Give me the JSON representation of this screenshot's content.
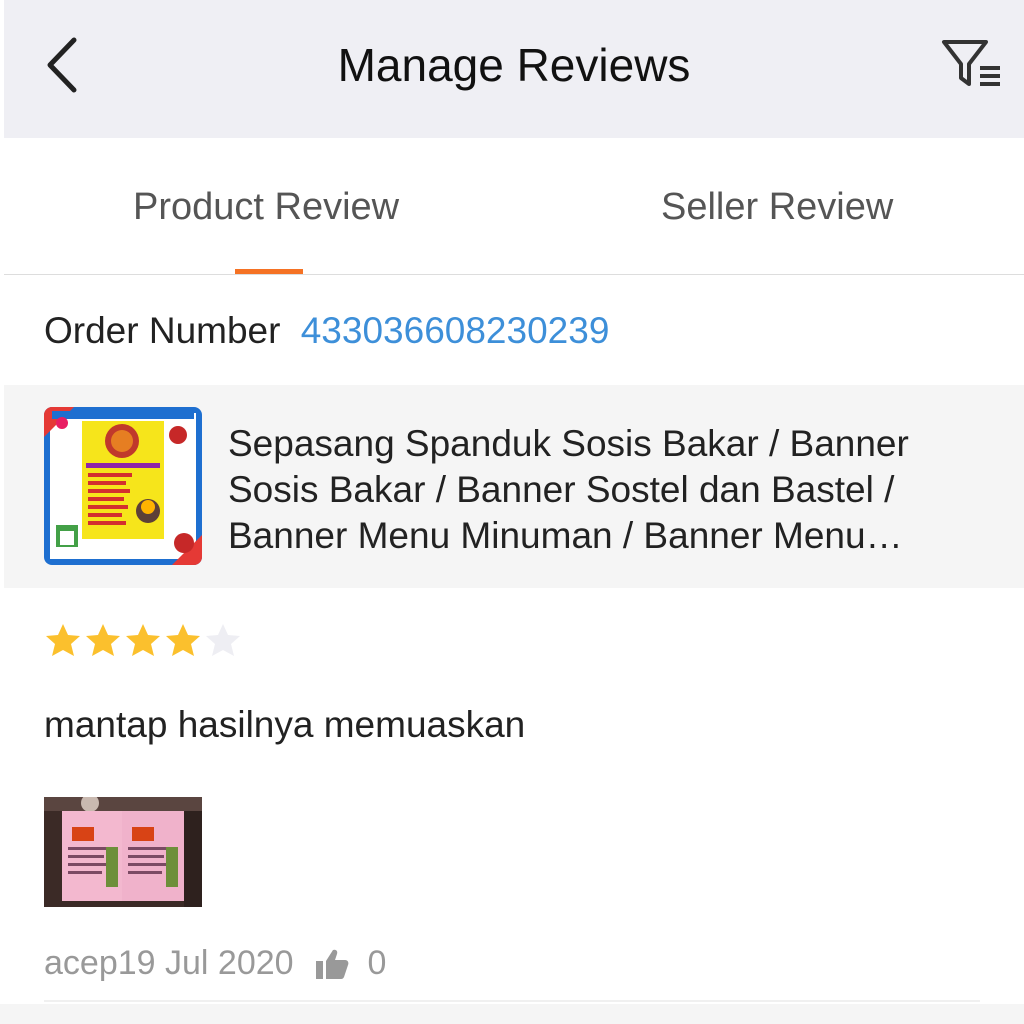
{
  "header": {
    "title": "Manage Reviews",
    "back_icon": "chevron-left-icon",
    "filter_icon": "filter-list-icon"
  },
  "tabs": [
    {
      "label": "Product Review",
      "active": true
    },
    {
      "label": "Seller Review",
      "active": false
    }
  ],
  "order": {
    "label": "Order Number",
    "number": "433036608230239"
  },
  "product": {
    "name": "Sepasang Spanduk Sosis Bakar / Banner Sosis Bakar / Banner Sostel dan Bastel / Banner Menu Minuman / Banner Menu Minuman",
    "thumbnail_icon": "product-banner-image"
  },
  "review": {
    "rating": 4,
    "max_rating": 5,
    "text": "mantap hasilnya memuaskan",
    "photo_icon": "review-photo",
    "author": "acep",
    "date": "19 Jul 2020",
    "likes": "0"
  },
  "colors": {
    "accent": "#f57224",
    "link": "#3d8fd9",
    "star_filled": "#fbc02d",
    "star_empty": "#eeeef3",
    "header_bg": "#efeff4"
  }
}
